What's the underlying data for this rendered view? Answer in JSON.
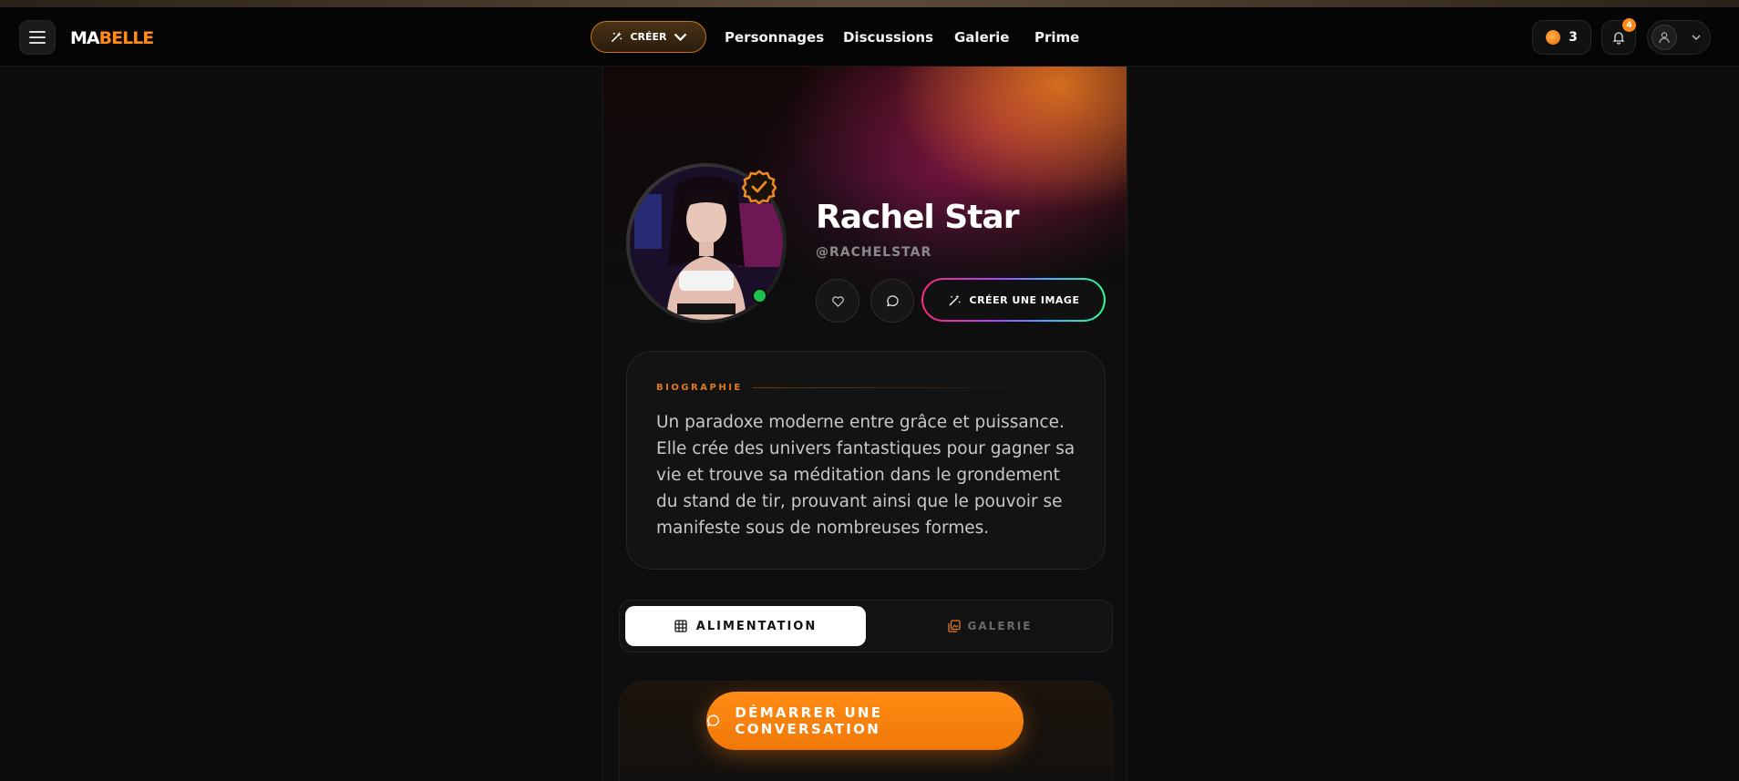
{
  "header": {
    "logo_part1": "MA",
    "logo_part2": "BELLE",
    "create_label": "CRÉER",
    "nav": [
      "Personnages",
      "Discussions",
      "Galerie",
      "Prime"
    ],
    "coins": "3",
    "notifications": "4"
  },
  "profile": {
    "name": "Rachel Star",
    "handle": "@RACHELSTAR",
    "create_image_label": "CRÉER UNE IMAGE"
  },
  "bio": {
    "label": "BIOGRAPHIE",
    "text": "Un paradoxe moderne entre grâce et puissance. Elle crée des univers fantastiques pour gagner sa vie et trouve sa méditation dans le grondement du stand de tir, prouvant ainsi que le pouvoir se manifeste sous de nombreuses formes."
  },
  "tabs": {
    "active": "ALIMENTATION",
    "inactive": "GALERIE"
  },
  "cta": {
    "label": "DÉMARRER UNE CONVERSATION"
  },
  "colors": {
    "accent": "#ff8a1a",
    "online": "#1cc24f"
  }
}
